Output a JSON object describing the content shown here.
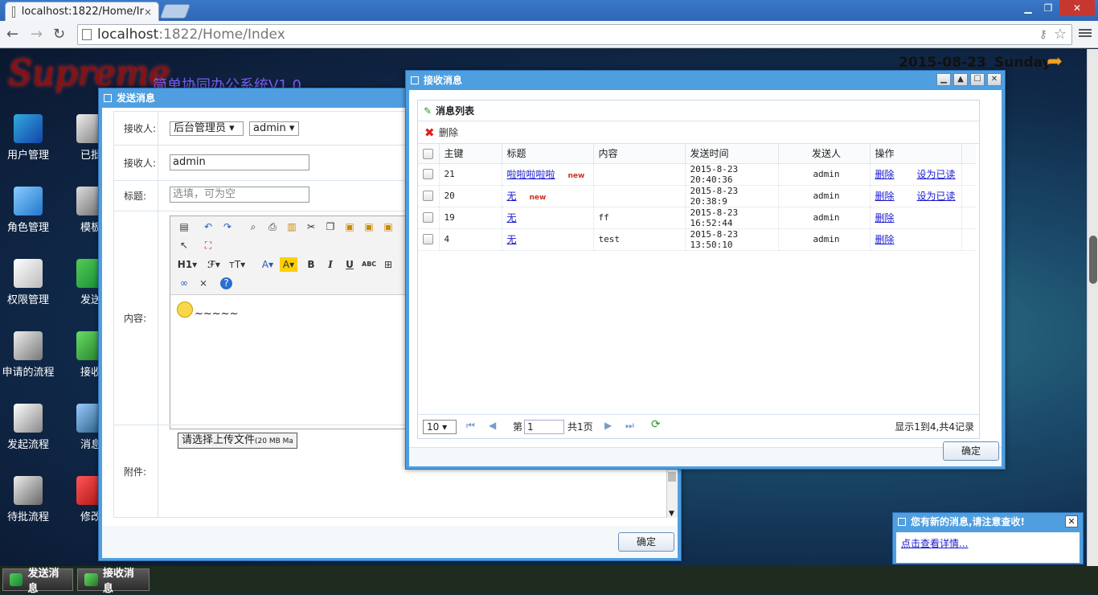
{
  "browser": {
    "tab_title": "localhost:1822/Home/Ir",
    "url_host": "localhost",
    "url_rest": ":1822/Home/Index",
    "close_glyph": "×"
  },
  "desktop": {
    "system_title": "简单协同办公系统V1.0",
    "logo_text": "Supreme",
    "date": "2015-08-23",
    "weekday": "Sunday",
    "icons_col1": [
      "用户管理",
      "角色管理",
      "权限管理",
      "申请的流程",
      "发起流程",
      "待批流程"
    ],
    "icons_col2": [
      "已批",
      "模板",
      "发送",
      "接收",
      "消息",
      "修改"
    ]
  },
  "send_window": {
    "title": "发送消息",
    "label_receiver": "接收人:",
    "select_dept": "后台管理员",
    "select_user": "admin",
    "label_receiver2": "接收人:",
    "receiver_value": "admin",
    "label_subject": "标题:",
    "subject_placeholder": "选填，可为空",
    "label_content": "内容:",
    "content_text": "~~~~~",
    "label_attach": "附件:",
    "upload_label": "请选择上传文件",
    "upload_note": "(20 MB Ma",
    "ok_label": "确定"
  },
  "recv_window": {
    "title": "接收消息",
    "panel_title": "消息列表",
    "delete_tool": "删除",
    "columns": [
      "主键",
      "标题",
      "内容",
      "发送时间",
      "发送人",
      "操作"
    ],
    "rows": [
      {
        "id": "21",
        "subject": "啦啦啦啦啦",
        "is_new": true,
        "content": "",
        "time": "2015-8-23 20:40:36",
        "sender": "admin",
        "op_delete": "删除",
        "op_read": "设为已读"
      },
      {
        "id": "20",
        "subject": "无",
        "is_new": true,
        "content": "",
        "time": "2015-8-23 20:38:9",
        "sender": "admin",
        "op_delete": "删除",
        "op_read": "设为已读"
      },
      {
        "id": "19",
        "subject": "无",
        "is_new": false,
        "content": "ff",
        "time": "2015-8-23 16:52:44",
        "sender": "admin",
        "op_delete": "删除",
        "op_read": ""
      },
      {
        "id": "4",
        "subject": "无",
        "is_new": false,
        "content": "test",
        "time": "2015-8-23 13:50:10",
        "sender": "admin",
        "op_delete": "删除",
        "op_read": ""
      }
    ],
    "new_badge": "new",
    "pager": {
      "page_size": "10",
      "page_prefix": "第",
      "page_value": "1",
      "page_total": "共1页",
      "summary": "显示1到4,共4记录"
    },
    "ok_label": "确定"
  },
  "notify": {
    "title": "您有新的消息,请注意查收!",
    "link": "点击查看详情..."
  },
  "taskbar": {
    "items": [
      "发送消息",
      "接收消息"
    ]
  }
}
